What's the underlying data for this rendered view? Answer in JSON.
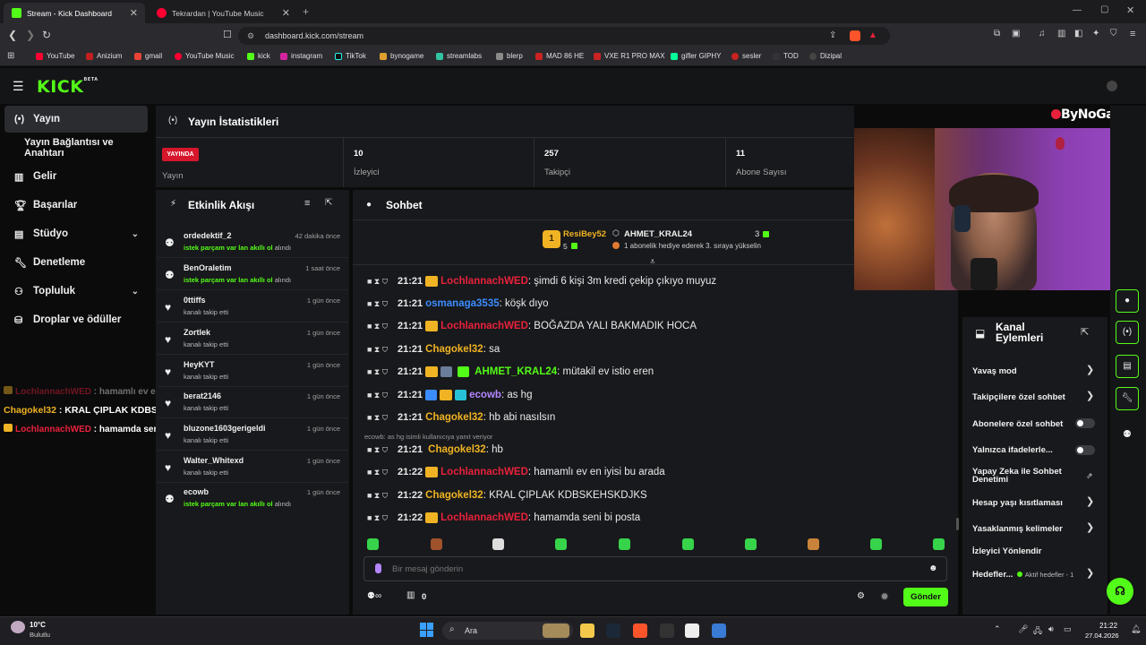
{
  "browser": {
    "tabs": [
      {
        "label": "Stream - Kick Dashboard",
        "active": true
      },
      {
        "label": "Tekrardan | YouTube Music",
        "active": false
      }
    ],
    "url": "dashboard.kick.com/stream",
    "bookmarks": [
      "YouTube",
      "Anizium",
      "gmail",
      "YouTube Music",
      "kick",
      "instagram",
      "TikTok",
      "bynogame",
      "streamlabs",
      "blerp",
      "MAD 86 HE",
      "VXE R1 PRO MAX",
      "gifler GIPHY",
      "sesler",
      "TOD",
      "Dizipal"
    ]
  },
  "logo": "KICK",
  "logo_sup": "BETA",
  "sidebar": {
    "items": [
      {
        "label": "Yayın",
        "icon": "broadcast-icon",
        "active": true
      },
      {
        "label": "Yayın Bağlantısı ve Anahtarı",
        "icon": "",
        "active": false
      },
      {
        "label": "Gelir",
        "icon": "chart-icon",
        "active": false
      },
      {
        "label": "Başarılar",
        "icon": "trophy-icon",
        "active": false
      },
      {
        "label": "Stüdyo",
        "icon": "studio-icon",
        "active": false
      },
      {
        "label": "Denetleme",
        "icon": "wrench-icon",
        "active": false
      },
      {
        "label": "Topluluk",
        "icon": "community-icon",
        "active": false
      },
      {
        "label": "Droplar ve ödüller",
        "icon": "drops-icon",
        "active": false
      }
    ]
  },
  "stats": {
    "title": "Yayın İstatistikleri",
    "live_badge": "YAYINDA",
    "live_label": "Yayın",
    "viewers_value": "10",
    "viewers_label": "İzleyici",
    "followers_value": "257",
    "followers_label": "Takipçi",
    "subs_value": "11",
    "subs_label": "Abone Sayısı"
  },
  "activity": {
    "title": "Etkinlik Akışı",
    "items": [
      {
        "name": "ordedektif_2",
        "time": "42 dakika önce",
        "desc_green": "istek parçam var lan akıllı ol",
        "desc": " alındı"
      },
      {
        "name": "BenOraletim",
        "time": "1 saat önce",
        "desc_green": "istek parçam var lan akıllı ol",
        "desc": " alındı"
      },
      {
        "name": "0ttiffs",
        "time": "1 gün önce",
        "desc_green": "",
        "desc": "kanalı takip etti"
      },
      {
        "name": "Zortlek",
        "time": "1 gün önce",
        "desc_green": "",
        "desc": "kanalı takip etti"
      },
      {
        "name": "HeyKYT",
        "time": "1 gün önce",
        "desc_green": "",
        "desc": "kanalı takip etti"
      },
      {
        "name": "berat2146",
        "time": "1 gün önce",
        "desc_green": "",
        "desc": "kanalı takip etti"
      },
      {
        "name": "bluzone1603gerigeldi",
        "time": "1 gün önce",
        "desc_green": "",
        "desc": "kanalı takip etti"
      },
      {
        "name": "Walter_Whitexd",
        "time": "1 gün önce",
        "desc_green": "",
        "desc": "kanalı takip etti"
      },
      {
        "name": "ecowb",
        "time": "1 gün önce",
        "desc_green": "istek parçam var lan akıllı ol",
        "desc": " alındı"
      }
    ]
  },
  "chat": {
    "title": "Sohbet",
    "pinned_user1": "ResiBey52",
    "pinned_user1_count": "5",
    "pinned_user2": "AHMET_KRAL24",
    "pinned_user2_count": "3",
    "pinned_desc": "1 abonelik hediye ederek 3. sıraya yükselin",
    "messages": [
      {
        "time": "21:21",
        "user": "LochlannachWED",
        "color": "#e8213b",
        "msg": ": şimdi 6 kişi 3m kredi çekip çıkıyo muyuz",
        "crown": true
      },
      {
        "time": "21:21",
        "user": "osmanaga3535",
        "color": "#3b8cff",
        "msg": ": köşk dıyo",
        "crown": false
      },
      {
        "time": "21:21",
        "user": "LochlannachWED",
        "color": "#e8213b",
        "msg": ": BOĞAZDA YALI BAKMADIK HOCA",
        "crown": true
      },
      {
        "time": "21:21",
        "user": "Chagokel32",
        "color": "#f0b323",
        "msg": ": sa",
        "crown": false
      },
      {
        "time": "21:21",
        "user": "AHMET_KRAL24",
        "color": "#53fc18",
        "msg": ": mütakil ev istio eren",
        "crown": true
      },
      {
        "time": "21:21",
        "user": "ecowb",
        "color": "#b387ff",
        "msg": ": as hg",
        "crown": true
      },
      {
        "time": "21:21",
        "user": "Chagokel32",
        "color": "#f0b323",
        "msg": ": hb abi nasılsın",
        "crown": false
      },
      {
        "time": "21:21",
        "user": "Chagokel32",
        "color": "#f0b323",
        "msg": ": hb",
        "crown": false
      },
      {
        "time": "21:22",
        "user": "LochlannachWED",
        "color": "#e8213b",
        "msg": ": hamamlı ev en iyisi bu arada",
        "crown": true
      },
      {
        "time": "21:22",
        "user": "Chagokel32",
        "color": "#f0b323",
        "msg": ": KRAL ÇIPLAK KDBSKEHSKDJKS",
        "crown": false
      },
      {
        "time": "21:22",
        "user": "LochlannachWED",
        "color": "#e8213b",
        "msg": ": hamamda seni bi posta",
        "crown": true
      }
    ],
    "reply_note": "ecowb: as hg isimli kullanıcıya yanıt veriyor",
    "input_placeholder": "Bir mesaj gönderin",
    "points": "0",
    "send_label": "Gönder"
  },
  "channel_actions": {
    "title_line1": "Kanal",
    "title_line2": "Eylemleri",
    "rows": [
      {
        "label": "Yavaş mod",
        "type": "chevron"
      },
      {
        "label": "Takipçilere özel sohbet",
        "type": "chevron"
      },
      {
        "label": "Abonelere özel sohbet",
        "type": "toggle"
      },
      {
        "label": "Yalnızca ifadelerle...",
        "type": "toggle"
      },
      {
        "label": "Yapay Zeka ile Sohbet",
        "label2": "Denetimi",
        "type": "link"
      },
      {
        "label": "Hesap yaşı kısıtlaması",
        "type": "chevron"
      },
      {
        "label": "Yasaklanmış kelimeler",
        "type": "chevron"
      },
      {
        "label": "İzleyici Yönlendir",
        "type": "none"
      },
      {
        "label": "Hedefler...",
        "extra": "Aktif hedefler - 1",
        "type": "chevron"
      }
    ]
  },
  "overlay": {
    "watermark": "ByNoGame",
    "lines": [
      {
        "user": "LochlannachWED",
        "msg": " : hamamlı ev en iyisi bu arada",
        "color": "#8a6a20"
      },
      {
        "user": "Chagokel32",
        "msg": " : KRAL ÇIPLAK KDBSKEHSKDJKS",
        "color": "#f0b323"
      },
      {
        "user": "LochlannachWED",
        "msg": " : hamamda seni bi posta",
        "color": "#e8213b"
      }
    ]
  },
  "taskbar": {
    "weather_temp": "10°C",
    "weather_desc": "Bulutlu",
    "search": "Ara",
    "time": "21:22",
    "date": "27.04.2026"
  }
}
